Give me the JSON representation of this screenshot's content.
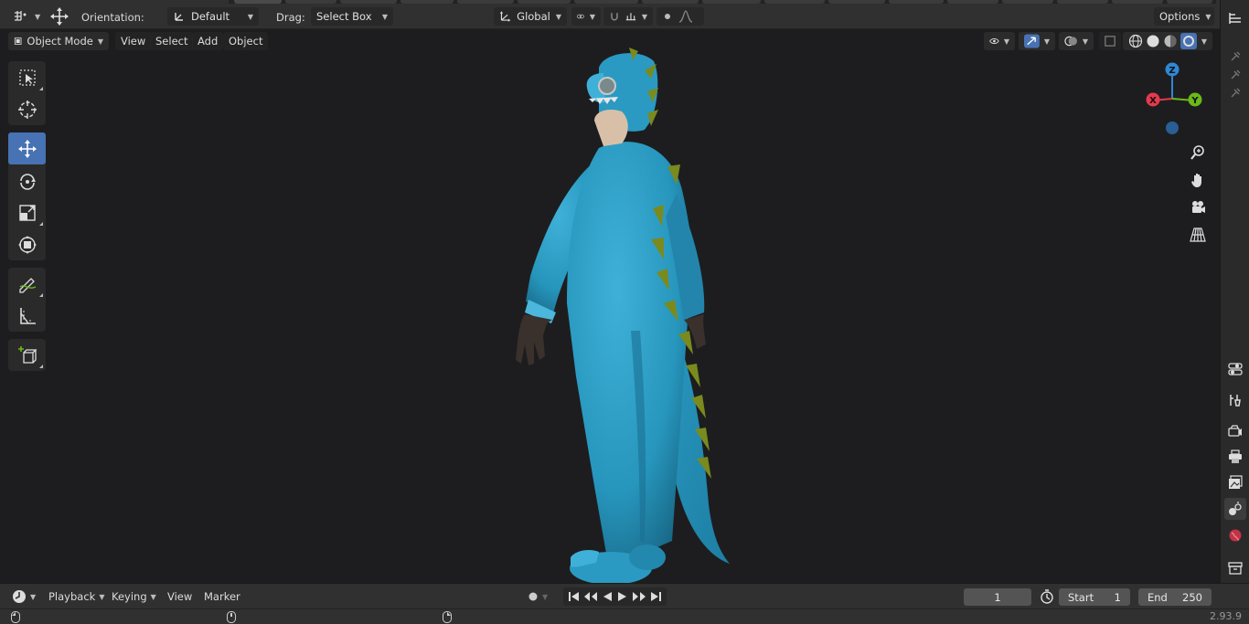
{
  "header": {
    "orientation_label": "Orientation:",
    "orientation_value": "Default",
    "drag_label": "Drag:",
    "drag_value": "Select Box",
    "transform_space": "Global",
    "options_label": "Options"
  },
  "viewport_header": {
    "mode": "Object Mode",
    "menus": [
      "View",
      "Select",
      "Add",
      "Object"
    ]
  },
  "toolbar": {
    "tools": [
      "select-box",
      "cursor",
      "move",
      "rotate",
      "scale",
      "transform",
      "annotate",
      "measure",
      "add-cube"
    ],
    "active_tool": "move"
  },
  "gizmo": {
    "axes": [
      "Z",
      "X",
      "Y"
    ]
  },
  "timeline": {
    "menus": [
      "Playback",
      "Keying",
      "View",
      "Marker"
    ],
    "current_frame": "1",
    "start_label": "Start",
    "start_value": "1",
    "end_label": "End",
    "end_value": "250"
  },
  "status": {
    "version": "2.93.9"
  },
  "colors": {
    "accent": "#4772b3",
    "axis_x": "#e5394f",
    "axis_y": "#6bb81a",
    "axis_z": "#2f87d6",
    "suit": "#2a9ac2",
    "spikes": "#7a8a1e"
  }
}
